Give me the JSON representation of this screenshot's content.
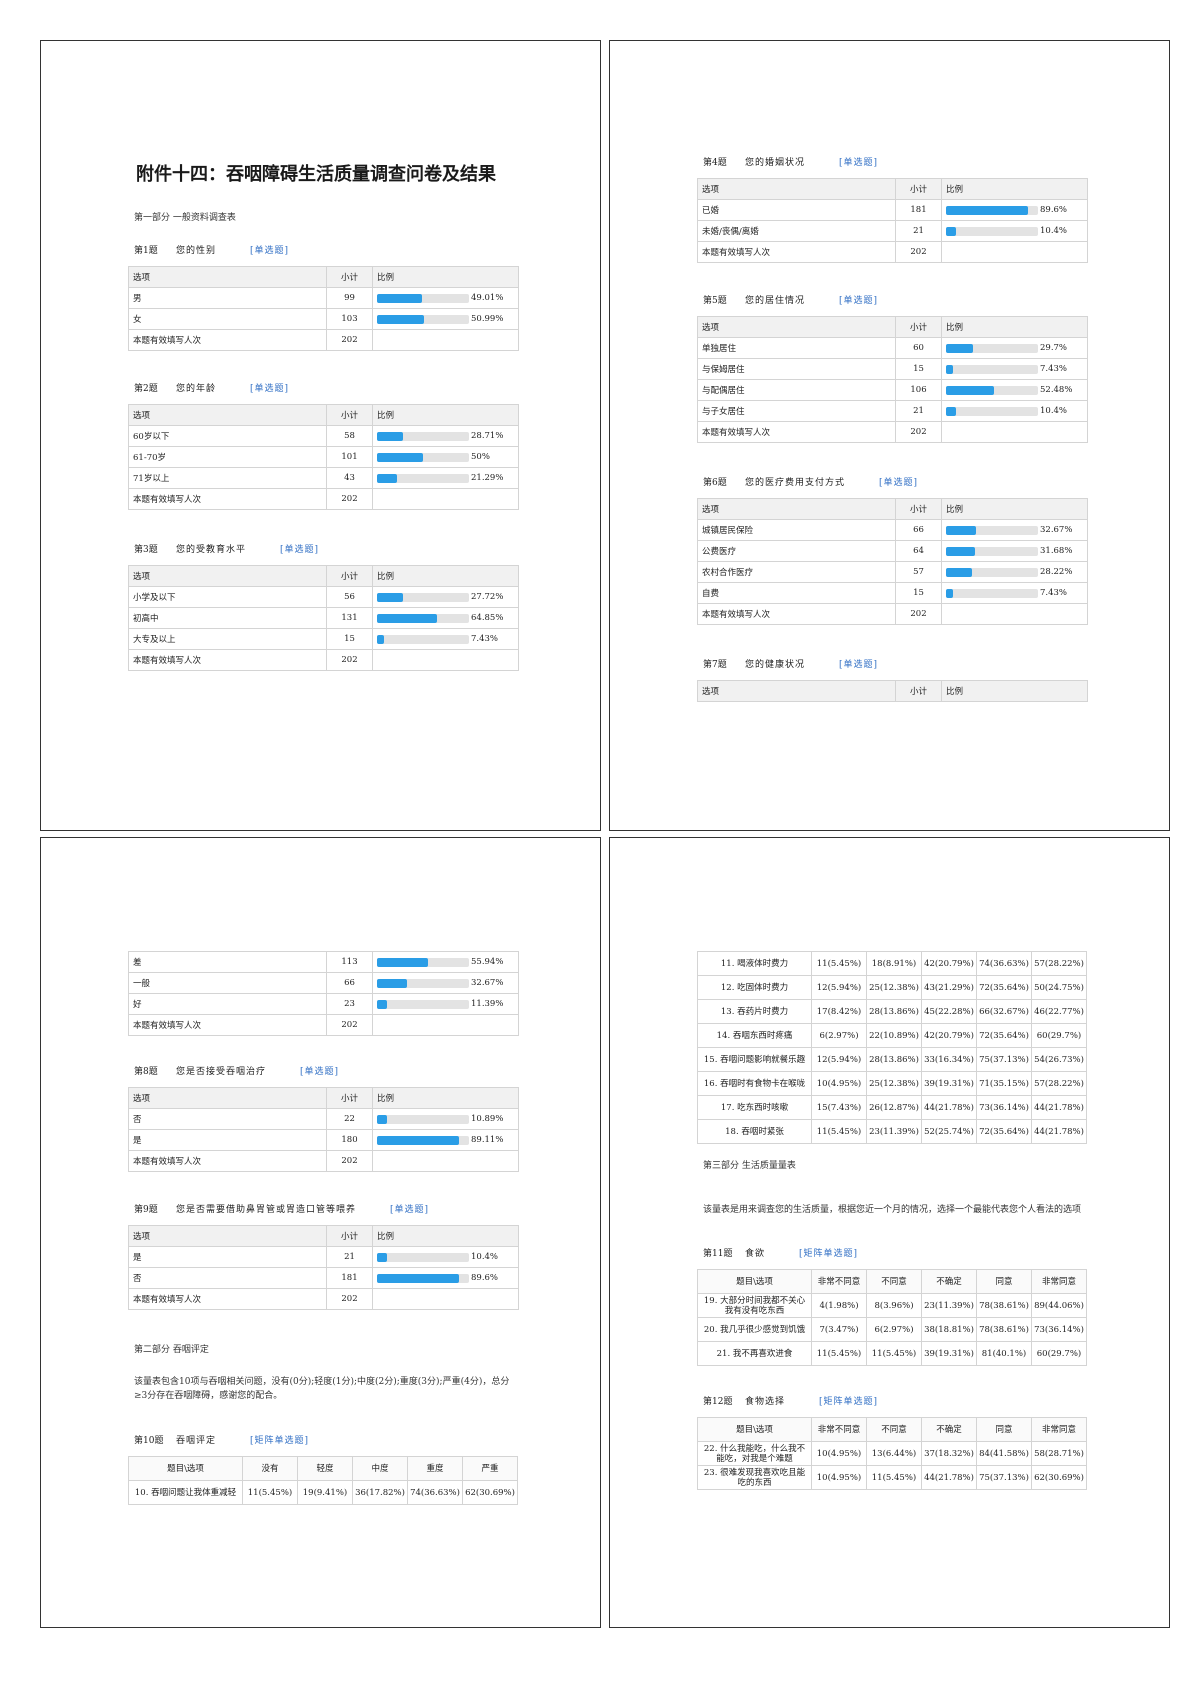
{
  "doc": {
    "title": "附件十四：吞咽障碍生活质量调查问卷及结果",
    "part1": "第一部分 一般资料调查表",
    "part2": "第二部分 吞咽评定",
    "part2_intro": "该量表包含10项与吞咽相关问题，没有(0分);轻度(1分);中度(2分);重度(3分);严重(4分)，总分≥3分存在吞咽障碍，感谢您的配合。",
    "part3": "第三部分 生活质量量表",
    "part3_intro": "该量表是用来调查您的生活质量，根据您近一个月的情况，选择一个最能代表您个人看法的选项"
  },
  "table_head": {
    "option": "选项",
    "count": "小计",
    "ratio": "比例"
  },
  "questions": {
    "q1": {
      "num": "第1题",
      "text": "您的性别",
      "type": "[单选题]",
      "rows": [
        {
          "label": "男",
          "count": "99",
          "pct": 49.01,
          "pct_text": "49.01%"
        },
        {
          "label": "女",
          "count": "103",
          "pct": 50.99,
          "pct_text": "50.99%"
        }
      ],
      "total_label": "本题有效填写人次",
      "total": "202"
    },
    "q2": {
      "num": "第2题",
      "text": "您的年龄",
      "type": "[单选题]",
      "rows": [
        {
          "label": "60岁以下",
          "count": "58",
          "pct": 28.71,
          "pct_text": "28.71%"
        },
        {
          "label": "61-70岁",
          "count": "101",
          "pct": 50,
          "pct_text": "50%"
        },
        {
          "label": "71岁以上",
          "count": "43",
          "pct": 21.29,
          "pct_text": "21.29%"
        }
      ],
      "total_label": "本题有效填写人次",
      "total": "202"
    },
    "q3": {
      "num": "第3题",
      "text": "您的受教育水平",
      "type": "[单选题]",
      "rows": [
        {
          "label": "小学及以下",
          "count": "56",
          "pct": 27.72,
          "pct_text": "27.72%"
        },
        {
          "label": "初高中",
          "count": "131",
          "pct": 64.85,
          "pct_text": "64.85%"
        },
        {
          "label": "大专及以上",
          "count": "15",
          "pct": 7.43,
          "pct_text": "7.43%"
        }
      ],
      "total_label": "本题有效填写人次",
      "total": "202"
    },
    "q4": {
      "num": "第4题",
      "text": "您的婚姻状况",
      "type": "[单选题]",
      "rows": [
        {
          "label": "已婚",
          "count": "181",
          "pct": 89.6,
          "pct_text": "89.6%"
        },
        {
          "label": "未婚/丧偶/离婚",
          "count": "21",
          "pct": 10.4,
          "pct_text": "10.4%"
        }
      ],
      "total_label": "本题有效填写人次",
      "total": "202"
    },
    "q5": {
      "num": "第5题",
      "text": "您的居住情况",
      "type": "[单选题]",
      "rows": [
        {
          "label": "单独居住",
          "count": "60",
          "pct": 29.7,
          "pct_text": "29.7%"
        },
        {
          "label": "与保姆居住",
          "count": "15",
          "pct": 7.43,
          "pct_text": "7.43%"
        },
        {
          "label": "与配偶居住",
          "count": "106",
          "pct": 52.48,
          "pct_text": "52.48%"
        },
        {
          "label": "与子女居住",
          "count": "21",
          "pct": 10.4,
          "pct_text": "10.4%"
        }
      ],
      "total_label": "本题有效填写人次",
      "total": "202"
    },
    "q6": {
      "num": "第6题",
      "text": "您的医疗费用支付方式",
      "type": "[单选题]",
      "rows": [
        {
          "label": "城镇居民保险",
          "count": "66",
          "pct": 32.67,
          "pct_text": "32.67%"
        },
        {
          "label": "公费医疗",
          "count": "64",
          "pct": 31.68,
          "pct_text": "31.68%"
        },
        {
          "label": "农村合作医疗",
          "count": "57",
          "pct": 28.22,
          "pct_text": "28.22%"
        },
        {
          "label": "自费",
          "count": "15",
          "pct": 7.43,
          "pct_text": "7.43%"
        }
      ],
      "total_label": "本题有效填写人次",
      "total": "202"
    },
    "q7": {
      "num": "第7题",
      "text": "您的健康状况",
      "type": "[单选题]",
      "rows": [
        {
          "label": "差",
          "count": "113",
          "pct": 55.94,
          "pct_text": "55.94%"
        },
        {
          "label": "一般",
          "count": "66",
          "pct": 32.67,
          "pct_text": "32.67%"
        },
        {
          "label": "好",
          "count": "23",
          "pct": 11.39,
          "pct_text": "11.39%"
        }
      ],
      "total_label": "本题有效填写人次",
      "total": "202"
    },
    "q8": {
      "num": "第8题",
      "text": "您是否接受吞咽治疗",
      "type": "[单选题]",
      "rows": [
        {
          "label": "否",
          "count": "22",
          "pct": 10.89,
          "pct_text": "10.89%"
        },
        {
          "label": "是",
          "count": "180",
          "pct": 89.11,
          "pct_text": "89.11%"
        }
      ],
      "total_label": "本题有效填写人次",
      "total": "202"
    },
    "q9": {
      "num": "第9题",
      "text": "您是否需要借助鼻胃管或胃造口管等喂养",
      "type": "[单选题]",
      "rows": [
        {
          "label": "是",
          "count": "21",
          "pct": 10.4,
          "pct_text": "10.4%"
        },
        {
          "label": "否",
          "count": "181",
          "pct": 89.6,
          "pct_text": "89.6%"
        }
      ],
      "total_label": "本题有效填写人次",
      "total": "202"
    }
  },
  "matrix": {
    "q10": {
      "num": "第10题",
      "text": "吞咽评定",
      "type": "[矩阵单选题]",
      "header": [
        "题目\\选项",
        "没有",
        "轻度",
        "中度",
        "重度",
        "严重"
      ],
      "rows": [
        [
          "10. 吞咽问题让我体重减轻",
          "11(5.45%)",
          "19(9.41%)",
          "36(17.82%)",
          "74(36.63%)",
          "62(30.69%)"
        ]
      ]
    },
    "q10cont": {
      "rows": [
        [
          "11. 喝液体时费力",
          "11(5.45%)",
          "18(8.91%)",
          "42(20.79%)",
          "74(36.63%)",
          "57(28.22%)"
        ],
        [
          "12. 吃固体时费力",
          "12(5.94%)",
          "25(12.38%)",
          "43(21.29%)",
          "72(35.64%)",
          "50(24.75%)"
        ],
        [
          "13. 吞药片时费力",
          "17(8.42%)",
          "28(13.86%)",
          "45(22.28%)",
          "66(32.67%)",
          "46(22.77%)"
        ],
        [
          "14. 吞咽东西时疼痛",
          "6(2.97%)",
          "22(10.89%)",
          "42(20.79%)",
          "72(35.64%)",
          "60(29.7%)"
        ],
        [
          "15. 吞咽问题影响就餐乐趣",
          "12(5.94%)",
          "28(13.86%)",
          "33(16.34%)",
          "75(37.13%)",
          "54(26.73%)"
        ],
        [
          "16. 吞咽时有食物卡在喉咙",
          "10(4.95%)",
          "25(12.38%)",
          "39(19.31%)",
          "71(35.15%)",
          "57(28.22%)"
        ],
        [
          "17. 吃东西时咳嗽",
          "15(7.43%)",
          "26(12.87%)",
          "44(21.78%)",
          "73(36.14%)",
          "44(21.78%)"
        ],
        [
          "18. 吞咽时紧张",
          "11(5.45%)",
          "23(11.39%)",
          "52(25.74%)",
          "72(35.64%)",
          "44(21.78%)"
        ]
      ]
    },
    "q11": {
      "num": "第11题",
      "text": "食欲",
      "type": "[矩阵单选题]",
      "header": [
        "题目\\选项",
        "非常不同意",
        "不同意",
        "不确定",
        "同意",
        "非常同意"
      ],
      "rows": [
        [
          "19. 大部分时间我都不关心我有没有吃东西",
          "4(1.98%)",
          "8(3.96%)",
          "23(11.39%)",
          "78(38.61%)",
          "89(44.06%)"
        ],
        [
          "20. 我几乎很少感觉到饥饿",
          "7(3.47%)",
          "6(2.97%)",
          "38(18.81%)",
          "78(38.61%)",
          "73(36.14%)"
        ],
        [
          "21. 我不再喜欢进食",
          "11(5.45%)",
          "11(5.45%)",
          "39(19.31%)",
          "81(40.1%)",
          "60(29.7%)"
        ]
      ]
    },
    "q12": {
      "num": "第12题",
      "text": "食物选择",
      "type": "[矩阵单选题]",
      "header": [
        "题目\\选项",
        "非常不同意",
        "不同意",
        "不确定",
        "同意",
        "非常同意"
      ],
      "rows": [
        [
          "22. 什么我能吃，什么我不能吃，对我是个难题",
          "10(4.95%)",
          "13(6.44%)",
          "37(18.32%)",
          "84(41.58%)",
          "58(28.71%)"
        ],
        [
          "23. 很难发现我喜欢吃且能吃的东西",
          "10(4.95%)",
          "11(5.45%)",
          "44(21.78%)",
          "75(37.13%)",
          "62(30.69%)"
        ]
      ]
    }
  }
}
